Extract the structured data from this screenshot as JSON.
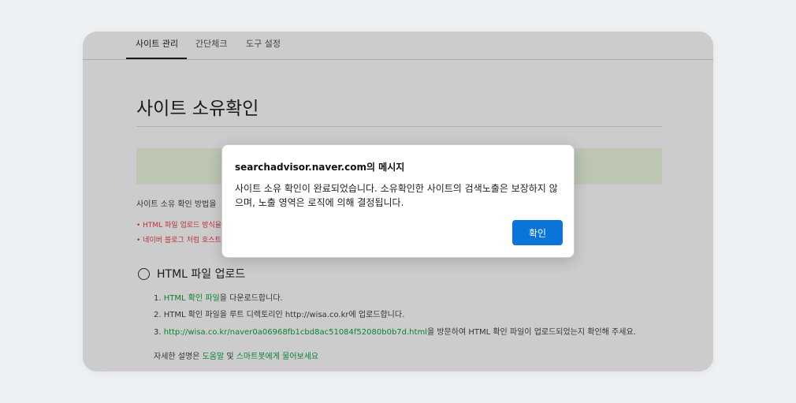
{
  "tabs": [
    {
      "label": "사이트 관리",
      "active": true
    },
    {
      "label": "간단체크",
      "active": false
    },
    {
      "label": "도구 설정",
      "active": false
    }
  ],
  "page": {
    "title": "사이트 소유확인",
    "method_text": "사이트 소유 확인 방법을",
    "warnings": [
      "• HTML 파일 업로드 방식을",
      "• 네이버 블로그 처럼 호스트"
    ]
  },
  "upload": {
    "radio_label": "HTML 파일 업로드",
    "steps": [
      {
        "num": "1.",
        "link": "HTML 확인 파일",
        "text": "을 다운로드합니다."
      },
      {
        "num": "2.",
        "link": "",
        "text": "HTML 확인 파일을 루트 디렉토리인 http://wisa.co.kr에 업로드합니다."
      },
      {
        "num": "3.",
        "link": "http://wisa.co.kr/naver0a06968fb1cbd8ac51084f52080b0b7d.html",
        "text": "을 방문하여 HTML 확인 파일이 업로드되었는지 확인해 주세요."
      }
    ],
    "help_prefix": "자세한 설명은 ",
    "help_link1": "도움말",
    "help_mid": " 및 ",
    "help_link2": "스마트봇에게 물어보세요"
  },
  "dialog": {
    "title_domain": "searchadvisor.naver.com",
    "title_suffix": "의 메시지",
    "message": "사이트 소유 확인이 완료되었습니다. 소유확인한 사이트의 검색노출은 보장하지 않으며, 노출 영역은 로직에 의해 결정됩니다.",
    "ok_label": "확인"
  },
  "colors": {
    "accent_green": "#10a43e",
    "warn_red": "#e8404b",
    "button_blue": "#0b74d8"
  }
}
